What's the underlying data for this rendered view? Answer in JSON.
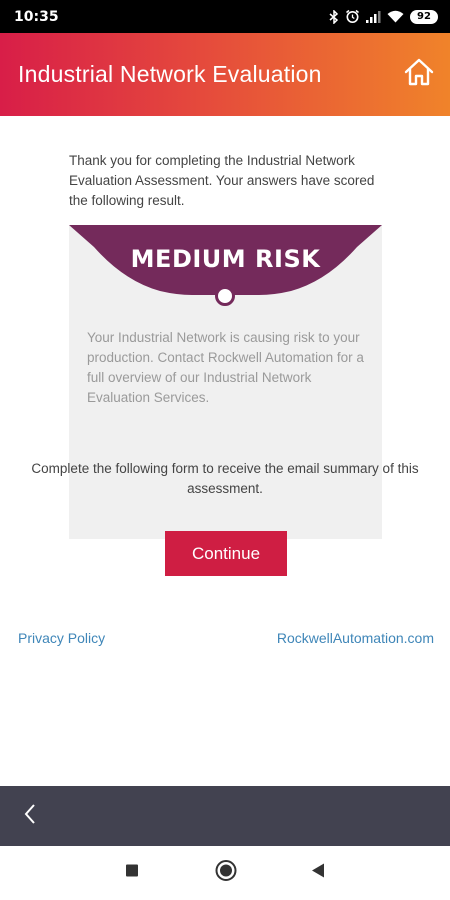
{
  "status_bar": {
    "time": "10:35",
    "battery_level": "92",
    "icons": [
      "bluetooth-icon",
      "alarm-icon",
      "signal-icon",
      "wifi-icon",
      "battery-icon"
    ]
  },
  "header": {
    "title": "Industrial Network Evaluation",
    "home_icon": "home-icon",
    "gradient_start": "#d81e48",
    "gradient_end": "#f0832a"
  },
  "main": {
    "intro_text": "Thank you for completing the Industrial Network Evaluation Assessment. Your answers have scored the following result.",
    "result": {
      "label": "MEDIUM RISK",
      "description": "Your Industrial Network is causing risk to your production. Contact Rockwell Automation for a full overview of our Industrial Network Evaluation Services.",
      "banner_color": "#742a5b"
    },
    "form_prompt": "Complete the following form to receive the email summary of this assessment.",
    "continue_label": "Continue",
    "continue_color": "#cf1e43",
    "links": {
      "privacy": "Privacy Policy",
      "rockwell": "RockwellAutomation.com",
      "link_color": "#3f86b8"
    }
  },
  "bottom_bar": {
    "back_icon": "chevron-left-icon",
    "color": "#424250"
  },
  "system_nav": {
    "icons": [
      "recents-square-icon",
      "home-circle-icon",
      "back-triangle-icon"
    ]
  }
}
